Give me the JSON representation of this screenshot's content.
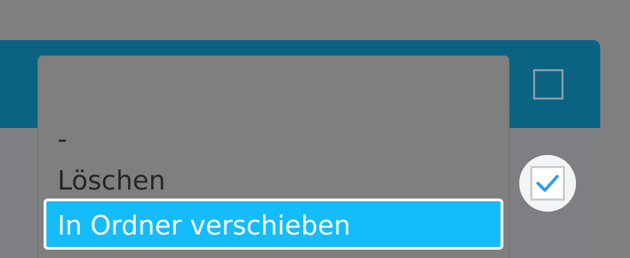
{
  "bulk_action_select": {
    "options": [
      "-",
      "Löschen",
      "In Ordner verschieben"
    ],
    "selected": "In Ordner verschieben"
  },
  "colors": {
    "overlay": "#808080",
    "header": "#0b6384",
    "selected_option": "#14bcfb",
    "check": "#2f9cf1"
  },
  "icons": {
    "header_checkbox": "checkbox-unchecked-icon",
    "row_checkbox": "checkbox-checked-icon"
  }
}
